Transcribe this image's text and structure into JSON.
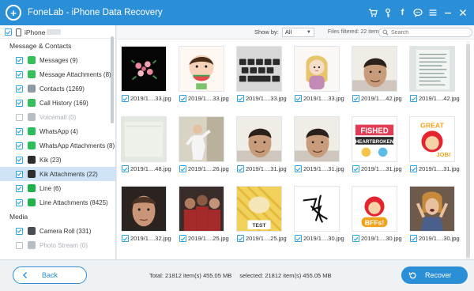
{
  "window": {
    "title": "FoneLab - iPhone Data Recovery",
    "icons": [
      "cart-icon",
      "key-icon",
      "facebook-icon",
      "chat-icon",
      "menu-icon",
      "minimize-icon",
      "close-icon"
    ]
  },
  "sidebar": {
    "device": "iPhone",
    "sections": [
      {
        "title": "Message & Contacts",
        "items": [
          {
            "label": "Messages (9)",
            "checked": true,
            "color": "#36c05a",
            "icon": "messages-icon"
          },
          {
            "label": "Message Attachments (8)",
            "checked": true,
            "color": "#36c05a",
            "icon": "message-attachments-icon"
          },
          {
            "label": "Contacts (1269)",
            "checked": true,
            "color": "#8c9aa6",
            "icon": "contacts-icon"
          },
          {
            "label": "Call History (169)",
            "checked": true,
            "color": "#36c05a",
            "icon": "call-history-icon"
          },
          {
            "label": "Voicemail (0)",
            "checked": false,
            "disabled": true,
            "color": "#b7bec5",
            "icon": "voicemail-icon"
          },
          {
            "label": "WhatsApp (4)",
            "checked": true,
            "color": "#2dbd5c",
            "icon": "whatsapp-icon"
          },
          {
            "label": "WhatsApp Attachments (8)",
            "checked": true,
            "color": "#2dbd5c",
            "icon": "whatsapp-attachments-icon"
          },
          {
            "label": "Kik (23)",
            "checked": true,
            "color": "#2d2d2d",
            "icon": "kik-icon"
          },
          {
            "label": "Kik Attachments (22)",
            "checked": true,
            "selected": true,
            "color": "#2d2d2d",
            "icon": "kik-attachments-icon"
          },
          {
            "label": "Line (6)",
            "checked": true,
            "color": "#22b24c",
            "icon": "line-icon"
          },
          {
            "label": "Line Attachments (8425)",
            "checked": true,
            "color": "#22b24c",
            "icon": "line-attachments-icon"
          }
        ]
      },
      {
        "title": "Media",
        "items": [
          {
            "label": "Camera Roll (331)",
            "checked": true,
            "color": "#4a4f55",
            "icon": "camera-roll-icon"
          },
          {
            "label": "Photo Stream (0)",
            "checked": false,
            "disabled": true,
            "color": "#b7bec5",
            "icon": "photo-stream-icon"
          }
        ]
      }
    ]
  },
  "filter": {
    "show_by_label": "Show by:",
    "show_by_value": "All",
    "files_filtered": "Files filtered: 22 item(s)",
    "search_placeholder": "Search"
  },
  "thumbnails": [
    {
      "caption": "2019/1....33.jpg",
      "subject": "flower-bouquet"
    },
    {
      "caption": "2019/1....33.jpg",
      "subject": "cartoon-boy-watermelon"
    },
    {
      "caption": "2019/1....33.jpg",
      "subject": "keyboard"
    },
    {
      "caption": "2019/1....33.jpg",
      "subject": "cartoon-girl"
    },
    {
      "caption": "2019/1....42.jpg",
      "subject": "man-selfie"
    },
    {
      "caption": "2019/1....42.jpg",
      "subject": "document-page"
    },
    {
      "caption": "2019/1....48.jpg",
      "subject": "blank-paper"
    },
    {
      "caption": "2019/1....26.jpg",
      "subject": "dancing-man"
    },
    {
      "caption": "2019/1....31.jpg",
      "subject": "man-selfie"
    },
    {
      "caption": "2019/1....31.jpg",
      "subject": "man-selfie"
    },
    {
      "caption": "2019/1....31.jpg",
      "subject": "fished-heartbroken-sticker"
    },
    {
      "caption": "2019/1....31.jpg",
      "subject": "great-job-sticker"
    },
    {
      "caption": "2019/1....32.jpg",
      "subject": "man-face"
    },
    {
      "caption": "2019/1....25.jpg",
      "subject": "group-photo"
    },
    {
      "caption": "2019/1....25.jpg",
      "subject": "cartoon-test"
    },
    {
      "caption": "2019/1....30.jpg",
      "subject": "signature"
    },
    {
      "caption": "2019/1....30.jpg",
      "subject": "bffs-sticker"
    },
    {
      "caption": "2019/1....30.jpg",
      "subject": "woman-cheering"
    }
  ],
  "sticker_text": {
    "fished_top": "FISHED",
    "fished_bottom": "HEARTBROKEN",
    "great": "GREAT",
    "job": "JOB!",
    "bffs": "BFFs!",
    "test": "TEST"
  },
  "footer": {
    "back_label": "Back",
    "total": "Total: 21812 item(s) 455.05 MB",
    "selected": "selected: 21812 item(s) 455.05 MB",
    "recover_label": "Recover"
  },
  "colors": {
    "accent": "#2a8fd6",
    "checkbox": "#2fa3e6",
    "selected_row": "#cfe5f7"
  }
}
